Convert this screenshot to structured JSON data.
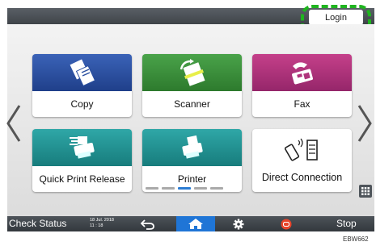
{
  "header": {
    "login_label": "Login"
  },
  "tiles": [
    {
      "label": "Copy"
    },
    {
      "label": "Scanner"
    },
    {
      "label": "Fax"
    },
    {
      "label": "Quick Print Release"
    },
    {
      "label": "Printer"
    },
    {
      "label": "Direct Connection"
    }
  ],
  "pager": {
    "pages": 5,
    "active_index": 2
  },
  "bottom_bar": {
    "check_status_label": "Check Status",
    "date": "18 Jul. 2018",
    "time": "11 : 18",
    "stop_label": "Stop"
  },
  "figure_code": "EBW662",
  "colors": {
    "copy": "#2a4fa0",
    "scanner": "#3a8f3a",
    "fax": "#b0347c",
    "print_release": "#239191",
    "home_active": "#1f75d6",
    "login_highlight": "#1fb41f"
  }
}
